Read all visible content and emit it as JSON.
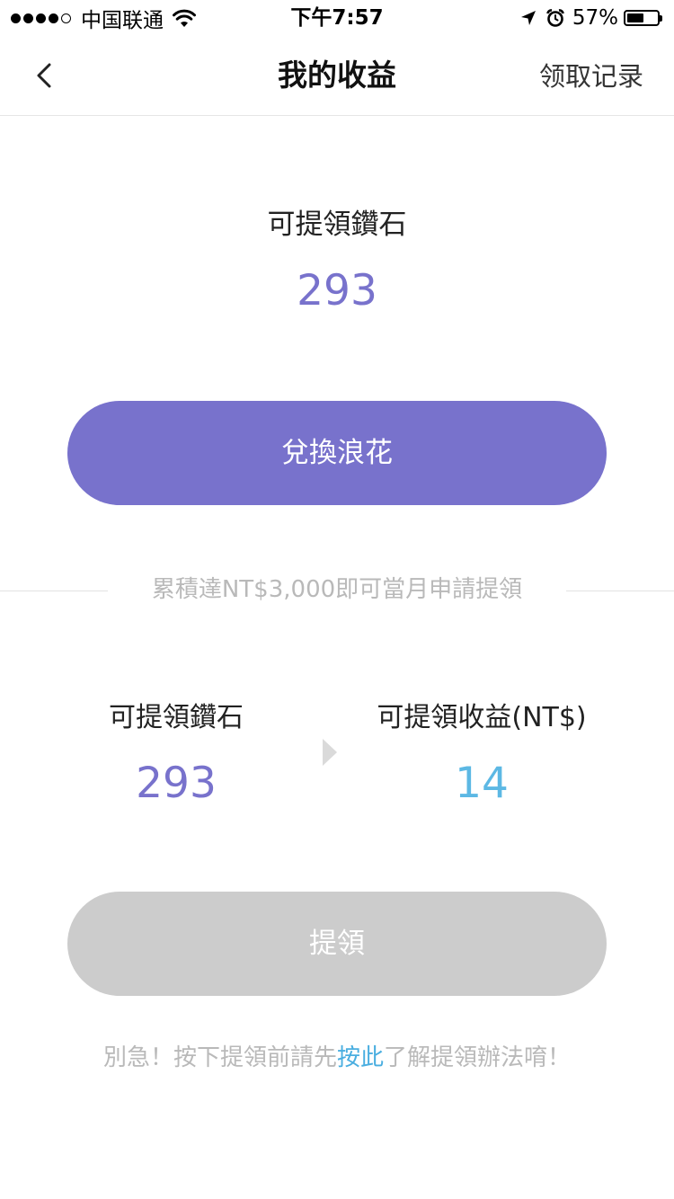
{
  "status_bar": {
    "carrier": "中国联通",
    "time": "下午7:57",
    "battery_percent": "57%",
    "battery_level": 0.57,
    "signal_bars_filled": 4,
    "signal_bars_total": 5,
    "icons": [
      "signal-dots-icon",
      "wifi-icon",
      "location-arrow-icon",
      "alarm-clock-icon",
      "battery-icon"
    ]
  },
  "nav": {
    "back_icon": "chevron-left-icon",
    "title": "我的收益",
    "right_action": "领取记录"
  },
  "diamonds": {
    "label": "可提領鑽石",
    "value": "293"
  },
  "exchange_button": {
    "label": "兌換浪花"
  },
  "threshold_note": "累積達NT$3,000即可當月申請提領",
  "withdraw_summary": {
    "left_label": "可提領鑽石",
    "left_value": "293",
    "right_label": "可提領收益(NT$)",
    "right_value": "14",
    "arrow_icon": "triangle-right-icon"
  },
  "withdraw_button": {
    "label": "提領",
    "state": "disabled"
  },
  "footer": {
    "before_link": "別急！按下提領前請先",
    "link_text": "按此",
    "after_link": "了解提領辦法唷！"
  },
  "colors": {
    "accent_purple": "#7872cc",
    "accent_blue": "#5cb8e4",
    "link_blue": "#4aaee0",
    "disabled_gray": "#cccccc",
    "hint_gray": "#b9b9b9"
  }
}
